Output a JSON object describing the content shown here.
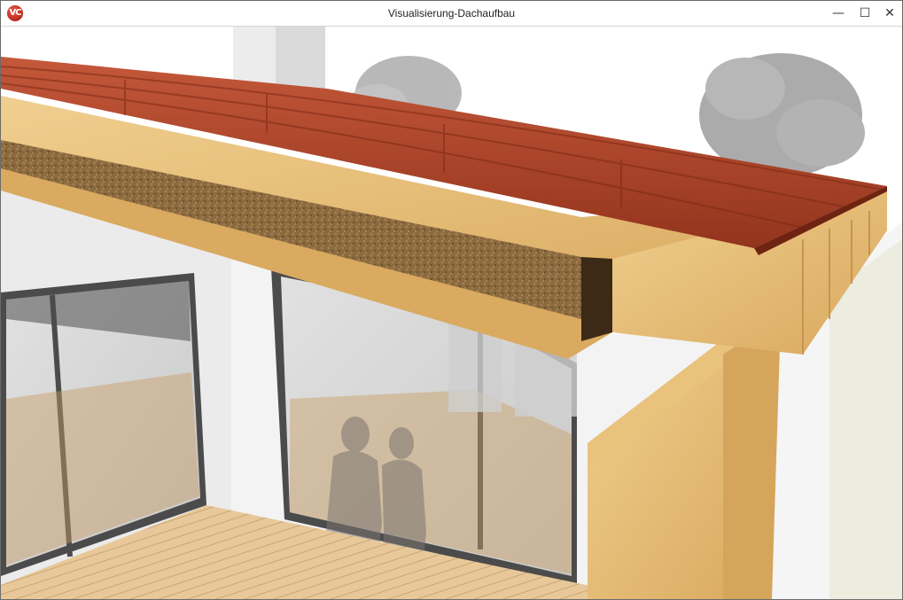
{
  "window": {
    "title": "Visualisierung-Dachaufbau",
    "app_icon_text": "VC",
    "controls": {
      "minimize": "—",
      "maximize": "☐",
      "close": "✕"
    }
  },
  "viewport": {
    "scene": "3d-roof-structure-visualization",
    "colors": {
      "roof_tiles": "#b44a2e",
      "timber": "#e3b970",
      "insulation": "#8a6a3f",
      "wall": "#f2f2f2",
      "deck": "#e6c595",
      "window_frame": "#4d4d4d",
      "sky": "#ffffff"
    }
  }
}
